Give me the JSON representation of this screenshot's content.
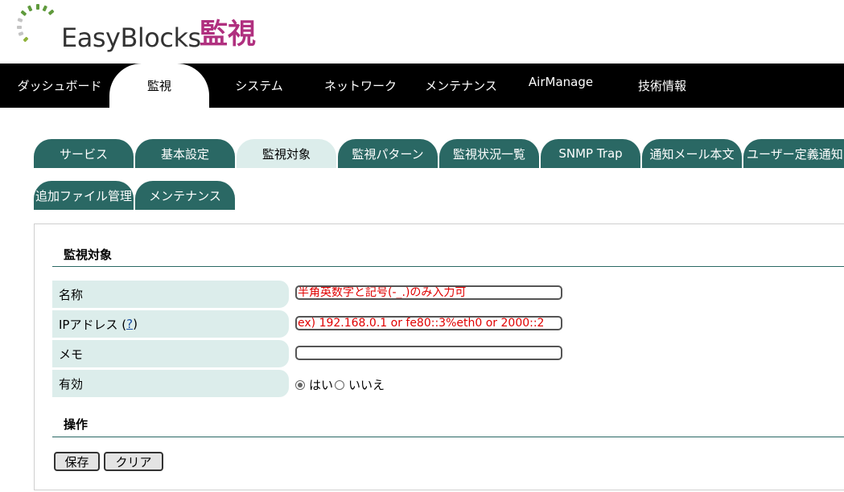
{
  "header": {
    "logo_text": "EasyBlocks",
    "page_title": "監視"
  },
  "topnav": {
    "items": [
      {
        "label": "ダッシュボード",
        "active": false
      },
      {
        "label": "監視",
        "active": true
      },
      {
        "label": "システム",
        "active": false
      },
      {
        "label": "ネットワーク",
        "active": false
      },
      {
        "label": "メンテナンス",
        "active": false
      },
      {
        "label": "AirManage",
        "active": false
      },
      {
        "label": "技術情報",
        "active": false
      }
    ]
  },
  "tabs": {
    "row1": [
      {
        "label": "サービス",
        "active": false
      },
      {
        "label": "基本設定",
        "active": false
      },
      {
        "label": "監視対象",
        "active": true
      },
      {
        "label": "監視パターン",
        "active": false
      },
      {
        "label": "監視状況一覧",
        "active": false
      },
      {
        "label": "SNMP Trap",
        "active": false
      },
      {
        "label": "通知メール本文",
        "active": false
      },
      {
        "label": "ユーザー定義通知",
        "active": false
      }
    ],
    "row2": [
      {
        "label": "追加ファイル管理",
        "active": false
      },
      {
        "label": "メンテナンス",
        "active": false
      }
    ]
  },
  "form": {
    "section_title": "監視対象",
    "name_label": "名称",
    "name_placeholder": "半角英数字と記号(-_.)のみ入力可",
    "ip_label": "IPアドレス (",
    "ip_help": "?",
    "ip_label_end": ")",
    "ip_placeholder": "ex) 192.168.0.1 or fe80::3%eth0 or 2000::2",
    "memo_label": "メモ",
    "memo_value": "",
    "enabled_label": "有効",
    "enabled_yes": "はい",
    "enabled_no": "いいえ",
    "enabled_selected": "はい"
  },
  "actions": {
    "section_title": "操作",
    "save_label": "保存",
    "clear_label": "クリア"
  },
  "colors": {
    "accent": "#2a6864",
    "tab_active": "#dcedeb",
    "title": "#b0307f",
    "placeholder": "#e00000"
  }
}
